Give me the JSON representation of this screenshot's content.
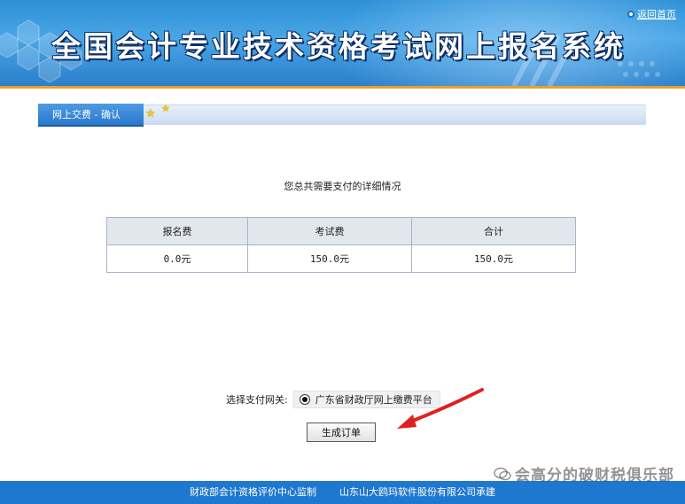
{
  "header": {
    "title": "全国会计专业技术资格考试网上报名系统",
    "return_link": "返回首页"
  },
  "breadcrumb": {
    "tab_label": "网上交费 - 确认"
  },
  "summary": {
    "title": "您总共需要支付的详细情况"
  },
  "fee_table": {
    "headers": [
      "报名费",
      "考试费",
      "合计"
    ],
    "values": [
      "0.0元",
      "150.0元",
      "150.0元"
    ]
  },
  "payment": {
    "label": "选择支付网关:",
    "option": "广东省财政厅网上缴费平台",
    "selected": true
  },
  "actions": {
    "submit_label": "生成订单"
  },
  "footer": {
    "left": "财政部会计资格评价中心监制",
    "right": "山东山大鸥玛软件股份有限公司承建"
  },
  "watermark": {
    "text": "会高分的破财税俱乐部"
  },
  "colors": {
    "banner": "#2d8fd6",
    "accent_line": "#e8a02c",
    "footer": "#1f78cf",
    "arrow": "#e02020"
  }
}
